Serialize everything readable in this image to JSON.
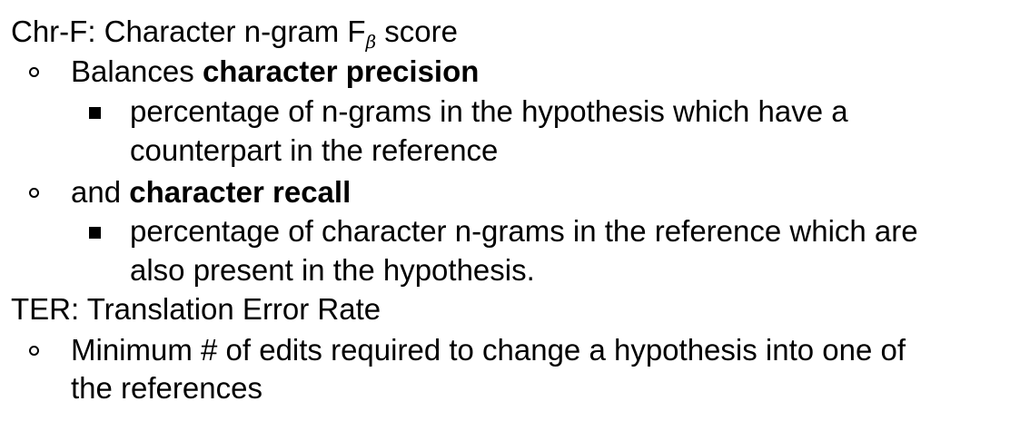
{
  "sections": [
    {
      "heading_prefix": "Chr-F: Character n-gram F",
      "heading_subscript": "β",
      "heading_suffix": " score",
      "items": [
        {
          "prefix": "Balances ",
          "bold": "character precision",
          "sub_items": [
            {
              "line1": "percentage of n-grams in the hypothesis which have a",
              "line2": "counterpart in the reference"
            }
          ]
        },
        {
          "prefix": "and ",
          "bold": "character recall",
          "sub_items": [
            {
              "line1": "percentage of character n-grams in the reference which are",
              "line2": "also present in the hypothesis."
            }
          ]
        }
      ]
    },
    {
      "heading": "TER: Translation Error Rate",
      "items": [
        {
          "line1": "Minimum # of edits required to change a hypothesis into one of",
          "line2": "the references"
        }
      ]
    }
  ]
}
